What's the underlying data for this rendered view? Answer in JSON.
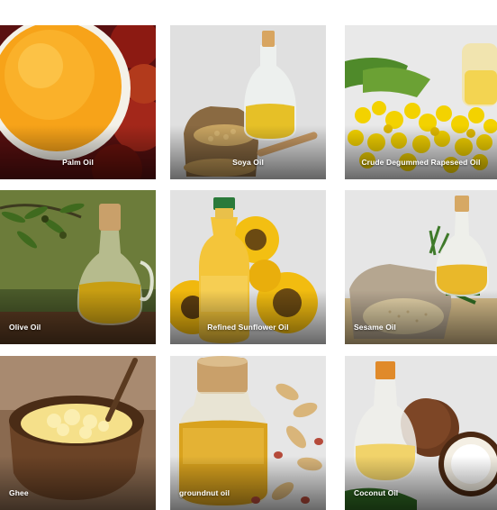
{
  "products": [
    {
      "name": "Palm Oil"
    },
    {
      "name": "Soya Oil"
    },
    {
      "name": "Crude Degummed Rapeseed Oil"
    },
    {
      "name": "Olive Oil"
    },
    {
      "name": "Refined Sunflower Oil"
    },
    {
      "name": "Sesame Oil"
    },
    {
      "name": "Ghee"
    },
    {
      "name": "groundnut oil"
    },
    {
      "name": "Coconut Oil"
    }
  ],
  "colors": {
    "label_text": "#ffffff",
    "oil_gold": "#e9b92a",
    "palm_orange": "#f29a12",
    "tile_gray": "#d9d9d9"
  }
}
